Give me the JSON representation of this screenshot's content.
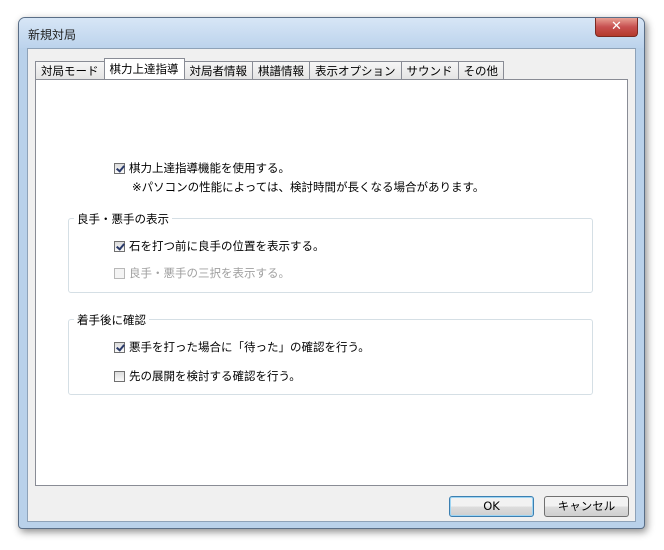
{
  "window": {
    "title": "新規対局",
    "close_symbol": "✕"
  },
  "tabs": [
    {
      "label": "対局モード",
      "active": false
    },
    {
      "label": "棋力上達指導",
      "active": true
    },
    {
      "label": "対局者情報",
      "active": false
    },
    {
      "label": "棋譜情報",
      "active": false
    },
    {
      "label": "表示オプション",
      "active": false
    },
    {
      "label": "サウンド",
      "active": false
    },
    {
      "label": "その他",
      "active": false
    }
  ],
  "main": {
    "enable_label": "棋力上達指導機能を使用する。",
    "enable_checked": true,
    "note": "※パソコンの性能によっては、検討時間が長くなる場合があります。"
  },
  "good_bad_group": {
    "title": "良手・悪手の表示",
    "show_position_label": "石を打つ前に良手の位置を表示する。",
    "show_position_checked": true,
    "three_choice_label": "良手・悪手の三択を表示する。",
    "three_choice_checked": false,
    "three_choice_enabled": false
  },
  "after_move_group": {
    "title": "着手後に確認",
    "wait_confirm_label": "悪手を打った場合に「待った」の確認を行う。",
    "wait_confirm_checked": true,
    "future_confirm_label": "先の展開を検討する確認を行う。",
    "future_confirm_checked": false
  },
  "buttons": {
    "ok": "OK",
    "cancel": "キャンセル"
  }
}
